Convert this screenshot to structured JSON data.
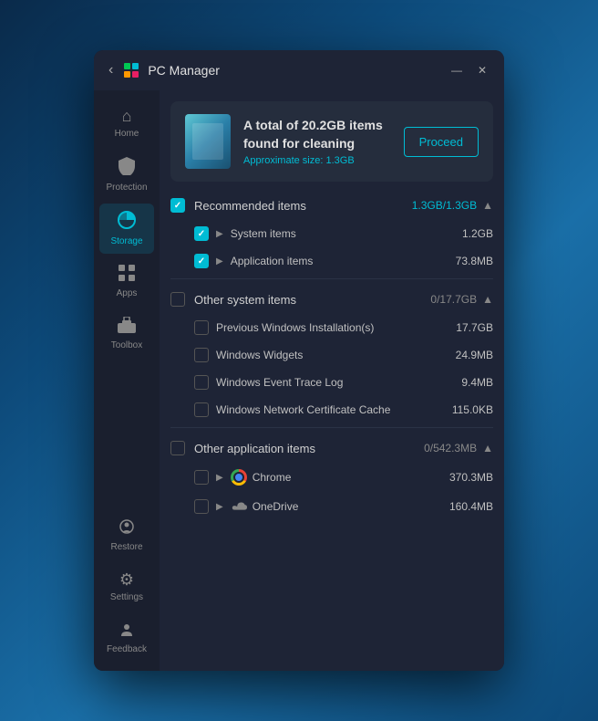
{
  "titlebar": {
    "back_label": "‹",
    "title": "PC Manager",
    "minimize_label": "—",
    "close_label": "✕"
  },
  "sidebar": {
    "items": [
      {
        "id": "home",
        "label": "Home",
        "icon": "⌂",
        "active": false
      },
      {
        "id": "protection",
        "label": "Protection",
        "icon": "🛡",
        "active": false
      },
      {
        "id": "storage",
        "label": "Storage",
        "icon": "◕",
        "active": true
      },
      {
        "id": "apps",
        "label": "Apps",
        "icon": "⊞",
        "active": false
      },
      {
        "id": "toolbox",
        "label": "Toolbox",
        "icon": "🧰",
        "active": false
      }
    ],
    "bottom_items": [
      {
        "id": "restore",
        "label": "Restore",
        "icon": "🔑",
        "active": false
      },
      {
        "id": "settings",
        "label": "Settings",
        "icon": "⚙",
        "active": false
      },
      {
        "id": "feedback",
        "label": "Feedback",
        "icon": "👤",
        "active": false
      }
    ]
  },
  "header": {
    "title_line1": "A total of 20.2GB items",
    "title_line2": "found for cleaning",
    "subtitle_prefix": "Approximate size: ",
    "subtitle_value": "1.3GB",
    "proceed_label": "Proceed"
  },
  "sections": [
    {
      "id": "recommended",
      "label": "Recommended items",
      "size": "1.3GB/1.3GB",
      "checked": true,
      "expanded": true,
      "size_color": "cyan",
      "children": [
        {
          "id": "system",
          "label": "System items",
          "size": "1.2GB",
          "checked": true,
          "expandable": true
        },
        {
          "id": "application",
          "label": "Application items",
          "size": "73.8MB",
          "checked": true,
          "expandable": true
        }
      ]
    },
    {
      "id": "other-system",
      "label": "Other system items",
      "size": "0/17.7GB",
      "checked": false,
      "expanded": true,
      "size_color": "gray",
      "children": [
        {
          "id": "prev-win",
          "label": "Previous Windows Installation(s)",
          "size": "17.7GB",
          "checked": false,
          "expandable": false
        },
        {
          "id": "widgets",
          "label": "Windows Widgets",
          "size": "24.9MB",
          "checked": false,
          "expandable": false
        },
        {
          "id": "event-log",
          "label": "Windows Event Trace Log",
          "size": "9.4MB",
          "checked": false,
          "expandable": false
        },
        {
          "id": "cert-cache",
          "label": "Windows Network Certificate Cache",
          "size": "115.0KB",
          "checked": false,
          "expandable": false
        }
      ]
    },
    {
      "id": "other-app",
      "label": "Other application items",
      "size": "0/542.3MB",
      "checked": false,
      "expanded": true,
      "size_color": "gray",
      "children": [
        {
          "id": "chrome",
          "label": "Chrome",
          "size": "370.3MB",
          "checked": false,
          "expandable": true,
          "icon": "chrome"
        },
        {
          "id": "onedrive",
          "label": "OneDrive",
          "size": "160.4MB",
          "checked": false,
          "expandable": true,
          "icon": "onedrive"
        }
      ]
    }
  ]
}
